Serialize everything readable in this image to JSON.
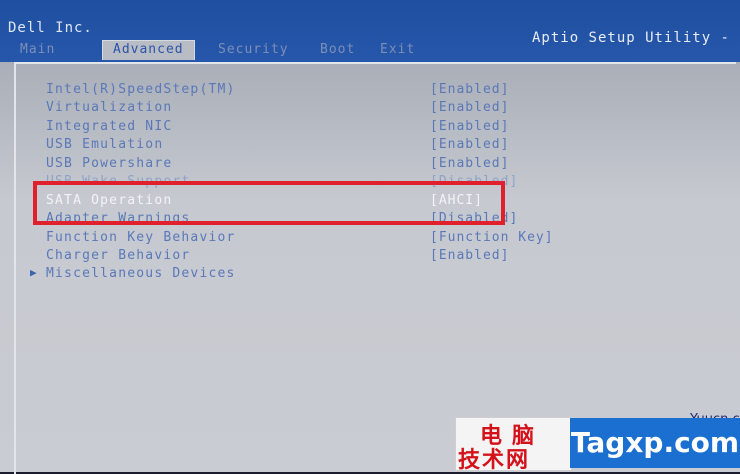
{
  "header": {
    "vendor": "Dell Inc.",
    "utility": "Aptio Setup Utility -"
  },
  "tabs": [
    {
      "label": "Main"
    },
    {
      "label": "Advanced"
    },
    {
      "label": "Security"
    },
    {
      "label": "Boot"
    },
    {
      "label": "Exit"
    }
  ],
  "settings": [
    {
      "label": "Intel(R)SpeedStep(TM)",
      "value": "[Enabled]"
    },
    {
      "label": "Virtualization",
      "value": "[Enabled]"
    },
    {
      "label": "Integrated NIC",
      "value": "[Enabled]"
    },
    {
      "label": "USB Emulation",
      "value": "[Enabled]"
    },
    {
      "label": "USB Powershare",
      "value": "[Enabled]"
    },
    {
      "label": "USB Wake Support",
      "value": "[Disabled]"
    },
    {
      "label": "SATA Operation",
      "value": "[AHCI]"
    },
    {
      "label": "Adapter Warnings",
      "value": "[Disabled]"
    },
    {
      "label": "Function Key Behavior",
      "value": "[Function Key]"
    },
    {
      "label": "Charger Behavior",
      "value": "[Enabled]"
    },
    {
      "label": "Miscellaneous Devices",
      "value": ""
    }
  ],
  "watermark": {
    "url": "Yuucn.com",
    "cn_line1": "电脑",
    "cn_line2": "技术网",
    "brand": "Tagxp.com"
  },
  "colors": {
    "header_blue": "#2757aa",
    "panel_grey": "#c6c9cf",
    "text_blue": "#5a78b8",
    "highlight_red": "#e0202a"
  }
}
